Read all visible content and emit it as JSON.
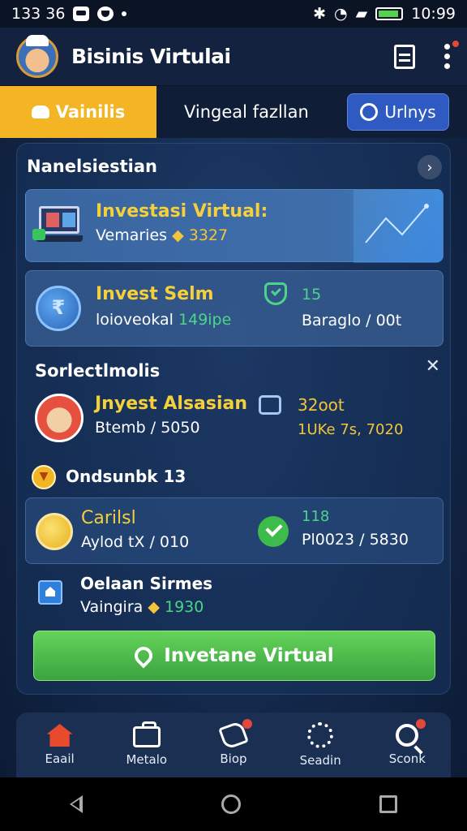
{
  "status_bar": {
    "time_left": "133 36",
    "time_right": "10:99"
  },
  "app_bar": {
    "title": "Bisinis Virtulai"
  },
  "tabs": {
    "active": "Vainilis",
    "second": "Vingeal fazllan",
    "pill": "Urlnys"
  },
  "section": {
    "title": "Nanelsiestian"
  },
  "card1": {
    "title": "Investasi Virtual:",
    "sub_label": "Vemaries",
    "sub_value": "3327"
  },
  "card2": {
    "title": "Invest Selm",
    "sub_label": "loioveokal",
    "sub_value": "149ipe",
    "right_top": "15",
    "right_bottom": "Baraglo / 00t"
  },
  "subsection": {
    "title": "Sorlectlmolis"
  },
  "row3": {
    "title": "Jnyest Alsasian",
    "sub": "Btemb / 5050",
    "right_top": "32oot",
    "right_bottom": "1UKe 7s, 7020"
  },
  "group": {
    "title": "Ondsunbk 13"
  },
  "card4": {
    "title": "Carilsl",
    "sub": "Aylod tX / 010",
    "right_top": "118",
    "right_bottom": "Pl0023 / 5830"
  },
  "row5": {
    "title": "Oelaan Sirmes",
    "sub_label": "Vaingira",
    "sub_value": "1930"
  },
  "cta": {
    "label": "Invetane Virtual"
  },
  "bottom_nav": [
    {
      "label": "Eaail"
    },
    {
      "label": "Metalo"
    },
    {
      "label": "Biop"
    },
    {
      "label": "Seadin"
    },
    {
      "label": "Sconk"
    }
  ]
}
